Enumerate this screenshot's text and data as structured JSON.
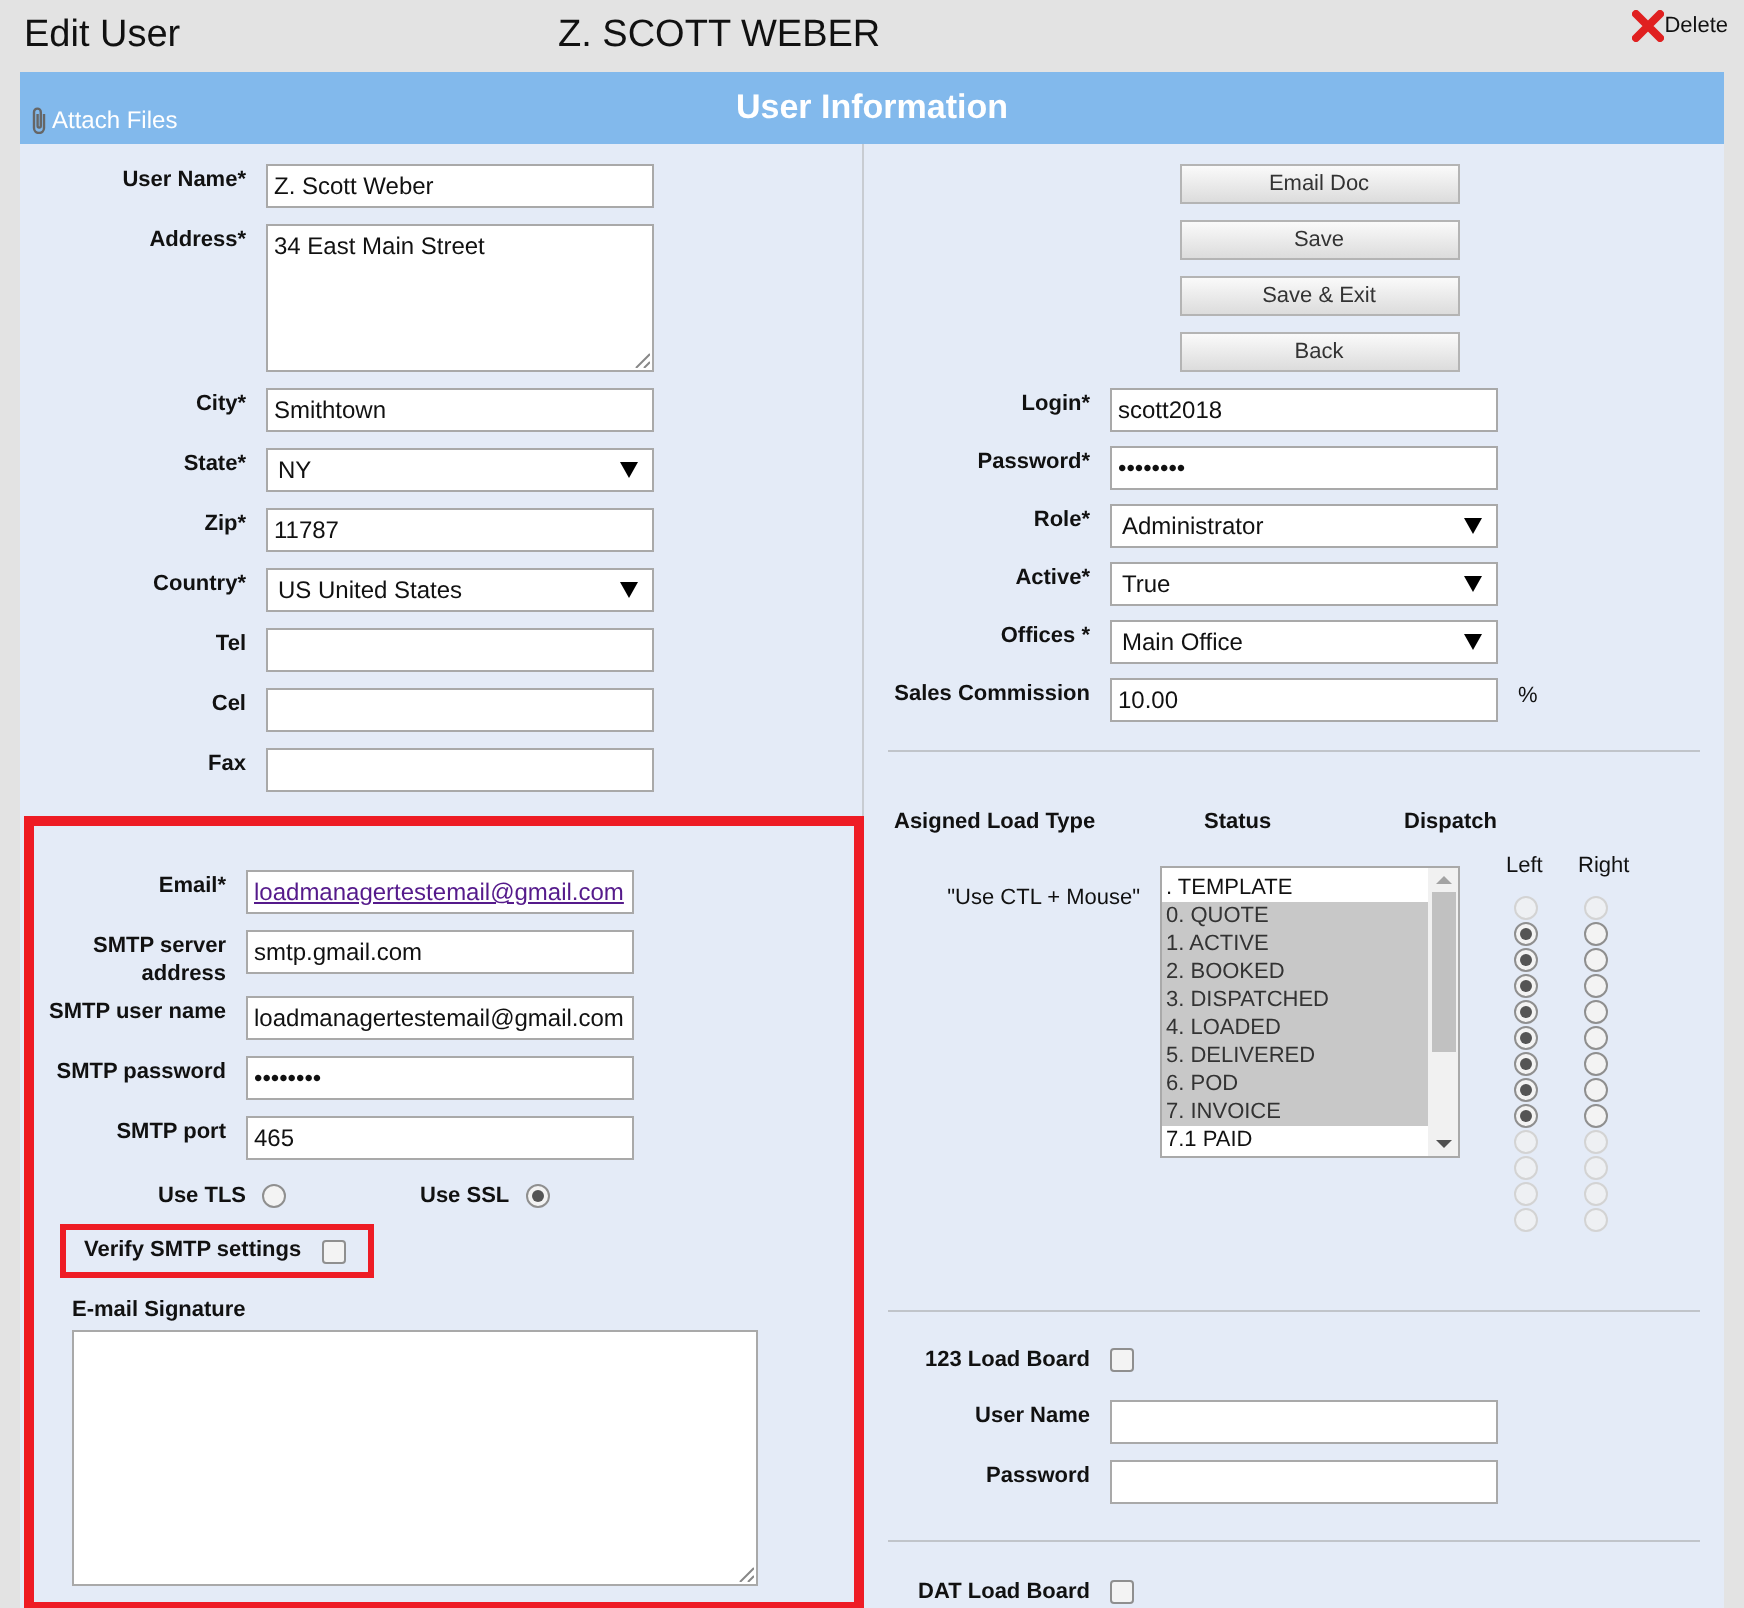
{
  "header": {
    "title": "Edit User",
    "user": "Z. SCOTT WEBER",
    "delete": "Delete"
  },
  "bar": {
    "attach": "Attach Files",
    "title": "User Information"
  },
  "left_fields": [
    {
      "label": "User Name*",
      "value": "Z. Scott Weber",
      "kind": "text"
    },
    {
      "label": "Address*",
      "value": "34 East Main Street",
      "kind": "textarea"
    },
    {
      "label": "City*",
      "value": "Smithtown",
      "kind": "text"
    },
    {
      "label": "State*",
      "value": "NY",
      "kind": "select"
    },
    {
      "label": "Zip*",
      "value": "11787",
      "kind": "text"
    },
    {
      "label": "Country*",
      "value": "US United States",
      "kind": "select"
    },
    {
      "label": "Tel",
      "kind": "text"
    },
    {
      "label": "Cel",
      "kind": "text"
    },
    {
      "label": "Fax",
      "kind": "text"
    }
  ],
  "email_fields": [
    {
      "label": "Email*",
      "value": "loadmanagertestemail@gmail.com",
      "kind": "link"
    },
    {
      "label": "SMTP server address",
      "value": "smtp.gmail.com",
      "kind": "text"
    },
    {
      "label": "SMTP user name",
      "value": "loadmanagertestemail@gmail.com",
      "kind": "text"
    },
    {
      "label": "SMTP password",
      "value": "••••••••",
      "kind": "text"
    },
    {
      "label": "SMTP port",
      "value": "465",
      "kind": "text"
    }
  ],
  "security": [
    {
      "label": "Use TLS",
      "selected": false
    },
    {
      "label": "Use SSL",
      "selected": true
    }
  ],
  "verify": {
    "label": "Verify SMTP settings",
    "checked": false
  },
  "signature": {
    "label": "E-mail Signature"
  },
  "buttons": [
    "Email Doc",
    "Save",
    "Save & Exit",
    "Back"
  ],
  "right_fields": [
    {
      "label": "Login*",
      "value": "scott2018",
      "kind": "text"
    },
    {
      "label": "Password*",
      "value": "••••••••",
      "kind": "text"
    },
    {
      "label": "Role*",
      "value": "Administrator",
      "kind": "select"
    },
    {
      "label": "Active*",
      "value": "True",
      "kind": "select"
    },
    {
      "label": "Offices *",
      "value": "Main Office",
      "kind": "select"
    },
    {
      "label": "Sales Commission",
      "value": "10.00",
      "kind": "text",
      "suffix": "%"
    }
  ],
  "load_types": {
    "heading": "Asigned Load Type",
    "status_heading": "Status",
    "dispatch_heading": "Dispatch",
    "left": "Left",
    "right": "Right",
    "hint": "\"Use CTL + Mouse\"",
    "statuses": [
      {
        "label": ". TEMPLATE",
        "selected": false
      },
      {
        "label": "0. QUOTE",
        "selected": true
      },
      {
        "label": "1. ACTIVE",
        "selected": true
      },
      {
        "label": "2. BOOKED",
        "selected": true
      },
      {
        "label": "3. DISPATCHED",
        "selected": true
      },
      {
        "label": "4. LOADED",
        "selected": true
      },
      {
        "label": "5. DELIVERED",
        "selected": true
      },
      {
        "label": "6. POD",
        "selected": true
      },
      {
        "label": "7. INVOICE",
        "selected": true
      },
      {
        "label": "7.1 PAID",
        "selected": false
      }
    ],
    "dispatch": [
      {
        "left": false,
        "right": false,
        "disabled": true
      },
      {
        "left": true,
        "right": false,
        "disabled": false
      },
      {
        "left": true,
        "right": false,
        "disabled": false
      },
      {
        "left": true,
        "right": false,
        "disabled": false
      },
      {
        "left": true,
        "right": false,
        "disabled": false
      },
      {
        "left": true,
        "right": false,
        "disabled": false
      },
      {
        "left": true,
        "right": false,
        "disabled": false
      },
      {
        "left": true,
        "right": false,
        "disabled": false
      },
      {
        "left": true,
        "right": false,
        "disabled": false
      },
      {
        "left": false,
        "right": false,
        "disabled": true
      },
      {
        "left": false,
        "right": false,
        "disabled": true
      },
      {
        "left": false,
        "right": false,
        "disabled": true
      },
      {
        "left": false,
        "right": false,
        "disabled": true
      }
    ]
  },
  "board_123": {
    "label": "123 Load Board",
    "checked": false,
    "fields": [
      {
        "label": "User Name"
      },
      {
        "label": "Password"
      }
    ]
  },
  "board_dat": {
    "label": "DAT Load Board",
    "checked": false
  }
}
